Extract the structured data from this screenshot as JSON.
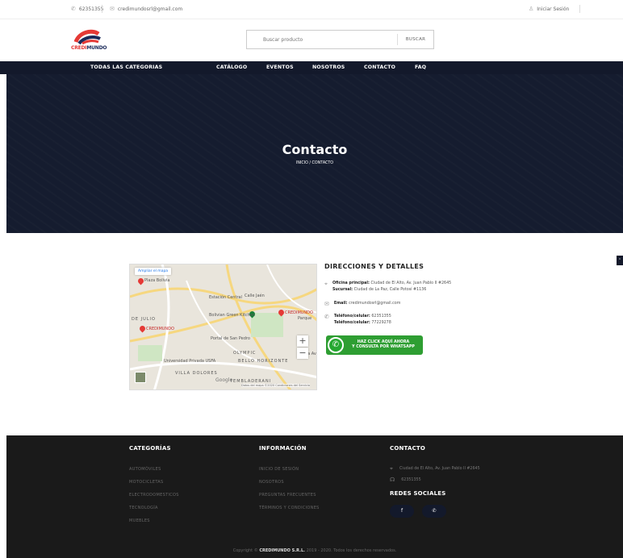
{
  "topbar": {
    "phone": "62351355",
    "email": "credimundosrl@gmail.com",
    "login": "Iniciar Sesión"
  },
  "header": {
    "logo_text": "CREDIMUNDO",
    "search_placeholder": "Buscar producto",
    "search_button": "BUSCAR"
  },
  "nav": {
    "items": [
      "TODAS LAS CATEGORIAS",
      "CATÁLOGO",
      "EVENTOS",
      "NOSOTROS",
      "CONTACTO",
      "FAQ"
    ]
  },
  "hero": {
    "title": "Contacto",
    "breadcrumb": "INICIO / CONTACTO"
  },
  "map": {
    "enlarge_label": "Ampliar el mapa",
    "labels": [
      "Plaza Bolivia",
      "Estación Central",
      "Calle Jaén",
      "Bolivian Green Kitchen",
      "CREDIMUNDO",
      "DE JULIO",
      "CREDIMUNDO",
      "Portal de San Pedro",
      "Universidad Privada USFA",
      "OLYMPIC",
      "BELLO HORIZONTE",
      "VILLA DOLORES",
      "TEMBLADERANI",
      "Parque",
      "Plaza Av"
    ],
    "google": "Google",
    "credits": "Datos del mapa ©2020  Condiciones del Servicio"
  },
  "details": {
    "title": "DIRECCIONES Y DETALLES",
    "office_label": "Oficina principal:",
    "office_value": "Ciudad de El Alto, Av. Juan Pablo II #2645",
    "branch_label": "Sucursal:",
    "branch_value": "Ciudad de La Paz, Calle Potosí #1136",
    "email_label": "Email:",
    "email_value": "credimundosrl@gmail.com",
    "phone_label": "Teléfono/celular:",
    "phone_value": "62351355",
    "phone2_label": "Teléfono/celular:",
    "phone2_value": "77229278",
    "whatsapp_line1": "HAZ CLICK AQUÍ AHORA",
    "whatsapp_line2": "Y CONSULTA POR WHATSAPP"
  },
  "footer": {
    "categories_title": "CATEGORÍAS",
    "categories": [
      "AUTOMÓVILES",
      "MOTOCICLETAS",
      "ELECTRODOMESTICOS",
      "TECNOLOGÍA",
      "MUEBLES"
    ],
    "info_title": "INFORMACIÓN",
    "info": [
      "INICIO DE SESIÓN",
      "NOSOTROS",
      "PREGUNTAS FRECUENTES",
      "TÉRMINOS Y CONDICIONES"
    ],
    "contact_title": "CONTACTO",
    "contact_address": "Ciudad de El Alto, Av. Juan Pablo II #2645",
    "contact_phone": "62351355",
    "social_title": "REDES SOCIALES",
    "copyright_prefix": "Copyright ©",
    "copyright_brand": "CREDIMUNDO S.R.L.",
    "copyright_suffix": "2019 - 2020. Todos los derechos reservados."
  },
  "colors": {
    "nav_bg": "#13192b",
    "footer_bg": "#1a1a1a",
    "whatsapp_green": "#2e9e32",
    "brand_red": "#e53935"
  }
}
